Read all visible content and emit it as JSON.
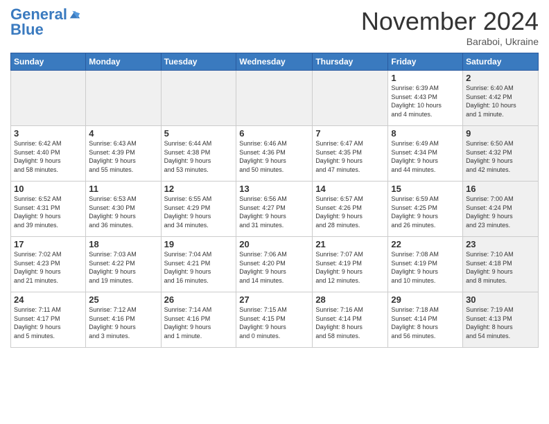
{
  "header": {
    "logo_main": "General",
    "logo_sub": "Blue",
    "month": "November 2024",
    "location": "Baraboi, Ukraine"
  },
  "weekdays": [
    "Sunday",
    "Monday",
    "Tuesday",
    "Wednesday",
    "Thursday",
    "Friday",
    "Saturday"
  ],
  "weeks": [
    [
      {
        "day": "",
        "detail": "",
        "shaded": true,
        "empty": true
      },
      {
        "day": "",
        "detail": "",
        "shaded": true,
        "empty": true
      },
      {
        "day": "",
        "detail": "",
        "shaded": true,
        "empty": true
      },
      {
        "day": "",
        "detail": "",
        "shaded": true,
        "empty": true
      },
      {
        "day": "",
        "detail": "",
        "shaded": true,
        "empty": true
      },
      {
        "day": "1",
        "detail": "Sunrise: 6:39 AM\nSunset: 4:43 PM\nDaylight: 10 hours\nand 4 minutes."
      },
      {
        "day": "2",
        "detail": "Sunrise: 6:40 AM\nSunset: 4:42 PM\nDaylight: 10 hours\nand 1 minute.",
        "shaded": true
      }
    ],
    [
      {
        "day": "3",
        "detail": "Sunrise: 6:42 AM\nSunset: 4:40 PM\nDaylight: 9 hours\nand 58 minutes."
      },
      {
        "day": "4",
        "detail": "Sunrise: 6:43 AM\nSunset: 4:39 PM\nDaylight: 9 hours\nand 55 minutes."
      },
      {
        "day": "5",
        "detail": "Sunrise: 6:44 AM\nSunset: 4:38 PM\nDaylight: 9 hours\nand 53 minutes."
      },
      {
        "day": "6",
        "detail": "Sunrise: 6:46 AM\nSunset: 4:36 PM\nDaylight: 9 hours\nand 50 minutes."
      },
      {
        "day": "7",
        "detail": "Sunrise: 6:47 AM\nSunset: 4:35 PM\nDaylight: 9 hours\nand 47 minutes."
      },
      {
        "day": "8",
        "detail": "Sunrise: 6:49 AM\nSunset: 4:34 PM\nDaylight: 9 hours\nand 44 minutes."
      },
      {
        "day": "9",
        "detail": "Sunrise: 6:50 AM\nSunset: 4:32 PM\nDaylight: 9 hours\nand 42 minutes.",
        "shaded": true
      }
    ],
    [
      {
        "day": "10",
        "detail": "Sunrise: 6:52 AM\nSunset: 4:31 PM\nDaylight: 9 hours\nand 39 minutes."
      },
      {
        "day": "11",
        "detail": "Sunrise: 6:53 AM\nSunset: 4:30 PM\nDaylight: 9 hours\nand 36 minutes."
      },
      {
        "day": "12",
        "detail": "Sunrise: 6:55 AM\nSunset: 4:29 PM\nDaylight: 9 hours\nand 34 minutes."
      },
      {
        "day": "13",
        "detail": "Sunrise: 6:56 AM\nSunset: 4:27 PM\nDaylight: 9 hours\nand 31 minutes."
      },
      {
        "day": "14",
        "detail": "Sunrise: 6:57 AM\nSunset: 4:26 PM\nDaylight: 9 hours\nand 28 minutes."
      },
      {
        "day": "15",
        "detail": "Sunrise: 6:59 AM\nSunset: 4:25 PM\nDaylight: 9 hours\nand 26 minutes."
      },
      {
        "day": "16",
        "detail": "Sunrise: 7:00 AM\nSunset: 4:24 PM\nDaylight: 9 hours\nand 23 minutes.",
        "shaded": true
      }
    ],
    [
      {
        "day": "17",
        "detail": "Sunrise: 7:02 AM\nSunset: 4:23 PM\nDaylight: 9 hours\nand 21 minutes."
      },
      {
        "day": "18",
        "detail": "Sunrise: 7:03 AM\nSunset: 4:22 PM\nDaylight: 9 hours\nand 19 minutes."
      },
      {
        "day": "19",
        "detail": "Sunrise: 7:04 AM\nSunset: 4:21 PM\nDaylight: 9 hours\nand 16 minutes."
      },
      {
        "day": "20",
        "detail": "Sunrise: 7:06 AM\nSunset: 4:20 PM\nDaylight: 9 hours\nand 14 minutes."
      },
      {
        "day": "21",
        "detail": "Sunrise: 7:07 AM\nSunset: 4:19 PM\nDaylight: 9 hours\nand 12 minutes."
      },
      {
        "day": "22",
        "detail": "Sunrise: 7:08 AM\nSunset: 4:19 PM\nDaylight: 9 hours\nand 10 minutes."
      },
      {
        "day": "23",
        "detail": "Sunrise: 7:10 AM\nSunset: 4:18 PM\nDaylight: 9 hours\nand 8 minutes.",
        "shaded": true
      }
    ],
    [
      {
        "day": "24",
        "detail": "Sunrise: 7:11 AM\nSunset: 4:17 PM\nDaylight: 9 hours\nand 5 minutes."
      },
      {
        "day": "25",
        "detail": "Sunrise: 7:12 AM\nSunset: 4:16 PM\nDaylight: 9 hours\nand 3 minutes."
      },
      {
        "day": "26",
        "detail": "Sunrise: 7:14 AM\nSunset: 4:16 PM\nDaylight: 9 hours\nand 1 minute."
      },
      {
        "day": "27",
        "detail": "Sunrise: 7:15 AM\nSunset: 4:15 PM\nDaylight: 9 hours\nand 0 minutes."
      },
      {
        "day": "28",
        "detail": "Sunrise: 7:16 AM\nSunset: 4:14 PM\nDaylight: 8 hours\nand 58 minutes."
      },
      {
        "day": "29",
        "detail": "Sunrise: 7:18 AM\nSunset: 4:14 PM\nDaylight: 8 hours\nand 56 minutes."
      },
      {
        "day": "30",
        "detail": "Sunrise: 7:19 AM\nSunset: 4:13 PM\nDaylight: 8 hours\nand 54 minutes.",
        "shaded": true
      }
    ]
  ]
}
